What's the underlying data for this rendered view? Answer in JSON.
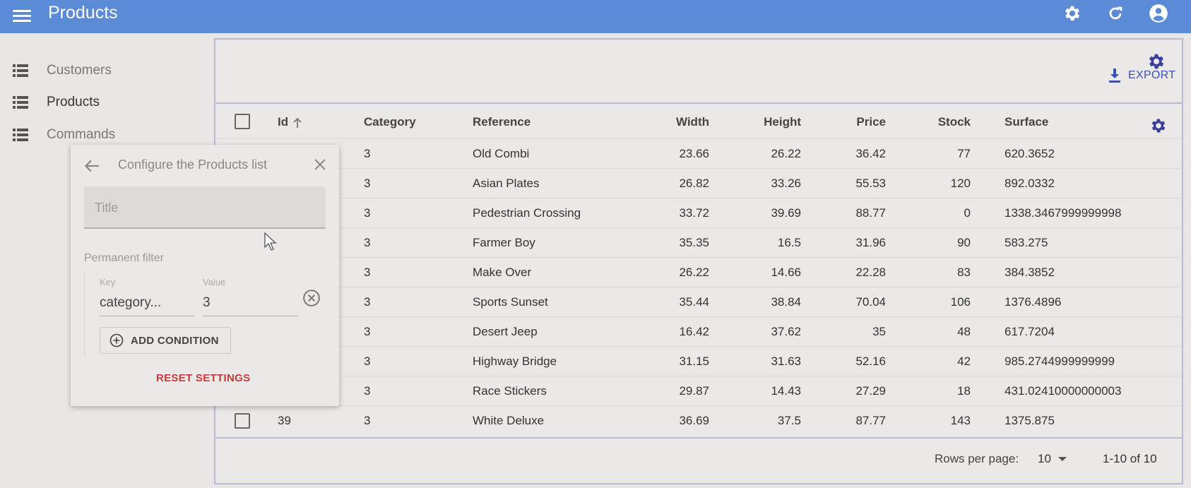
{
  "appbar": {
    "title": "Products",
    "icons": [
      "settings-icon",
      "refresh-icon",
      "account-icon"
    ]
  },
  "colors": {
    "appbar": "#5b8bd7",
    "accent": "#3f51b5",
    "danger": "#c63a3a"
  },
  "sidebar": {
    "items": [
      {
        "label": "Customers",
        "icon": "list-icon"
      },
      {
        "label": "Products",
        "icon": "list-icon",
        "active": true
      },
      {
        "label": "Commands",
        "icon": "list-icon"
      }
    ]
  },
  "toolbar": {
    "export_label": "EXPORT"
  },
  "table": {
    "columns": [
      "Id",
      "Category",
      "Reference",
      "Width",
      "Height",
      "Price",
      "Stock",
      "Surface"
    ],
    "sort_column": "Id",
    "rows": [
      {
        "id": "",
        "category": "3",
        "reference": "Old Combi",
        "width": "23.66",
        "height": "26.22",
        "price": "36.42",
        "stock": "77",
        "surface": "620.3652"
      },
      {
        "id": "",
        "category": "3",
        "reference": "Asian Plates",
        "width": "26.82",
        "height": "33.26",
        "price": "55.53",
        "stock": "120",
        "surface": "892.0332"
      },
      {
        "id": "",
        "category": "3",
        "reference": "Pedestrian Crossing",
        "width": "33.72",
        "height": "39.69",
        "price": "88.77",
        "stock": "0",
        "surface": "1338.3467999999998"
      },
      {
        "id": "",
        "category": "3",
        "reference": "Farmer Boy",
        "width": "35.35",
        "height": "16.5",
        "price": "31.96",
        "stock": "90",
        "surface": "583.275"
      },
      {
        "id": "",
        "category": "3",
        "reference": "Make Over",
        "width": "26.22",
        "height": "14.66",
        "price": "22.28",
        "stock": "83",
        "surface": "384.3852"
      },
      {
        "id": "",
        "category": "3",
        "reference": "Sports Sunset",
        "width": "35.44",
        "height": "38.84",
        "price": "70.04",
        "stock": "106",
        "surface": "1376.4896"
      },
      {
        "id": "",
        "category": "3",
        "reference": "Desert Jeep",
        "width": "16.42",
        "height": "37.62",
        "price": "35",
        "stock": "48",
        "surface": "617.7204"
      },
      {
        "id": "",
        "category": "3",
        "reference": "Highway Bridge",
        "width": "31.15",
        "height": "31.63",
        "price": "52.16",
        "stock": "42",
        "surface": "985.2744999999999"
      },
      {
        "id": "",
        "category": "3",
        "reference": "Race Stickers",
        "width": "29.87",
        "height": "14.43",
        "price": "27.29",
        "stock": "18",
        "surface": "431.02410000000003"
      },
      {
        "id": "39",
        "category": "3",
        "reference": "White Deluxe",
        "width": "36.69",
        "height": "37.5",
        "price": "87.77",
        "stock": "143",
        "surface": "1375.875"
      }
    ]
  },
  "pagination": {
    "rows_per_page_label": "Rows per page:",
    "rows_per_page": "10",
    "range": "1-10 of 10"
  },
  "config_panel": {
    "title": "Configure the Products list",
    "title_placeholder": "Title",
    "permanent_filter_label": "Permanent filter",
    "key_label": "Key",
    "key_value": "category...",
    "value_label": "Value",
    "value_value": "3",
    "add_condition_label": "ADD CONDITION",
    "reset_label": "RESET SETTINGS"
  }
}
